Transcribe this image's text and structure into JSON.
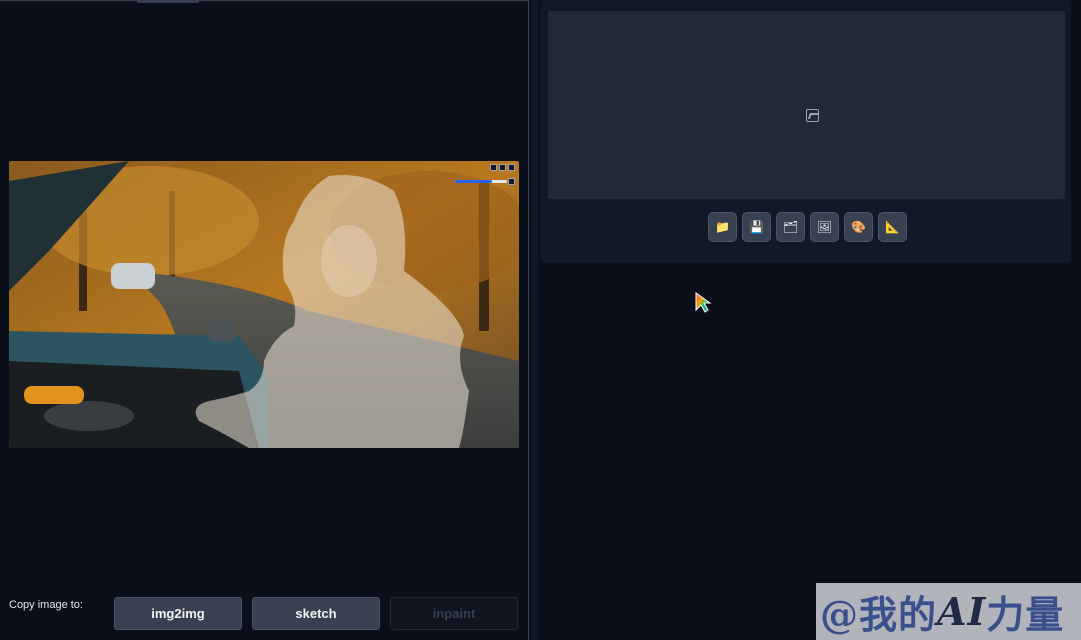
{
  "canvas": {
    "tools": [
      "expand-icon",
      "undo-icon",
      "close-icon"
    ],
    "brush_size_fraction": 0.72,
    "brush_color": "#111827"
  },
  "copy_row": {
    "label": "Copy image to:",
    "buttons": [
      {
        "label": "img2img",
        "enabled": true
      },
      {
        "label": "sketch",
        "enabled": true
      },
      {
        "label": "inpaint",
        "enabled": false
      }
    ]
  },
  "output": {
    "placeholder_icon": "image-icon",
    "toolbar": [
      {
        "icon": "folder-icon",
        "glyph": "📁"
      },
      {
        "icon": "save-icon",
        "glyph": "💾"
      },
      {
        "icon": "zip-icon",
        "glyph": "🗂"
      },
      {
        "icon": "send-image-icon",
        "glyph": "🖼"
      },
      {
        "icon": "palette-icon",
        "glyph": "🎨"
      },
      {
        "icon": "triangle-ruler-icon",
        "glyph": "📐"
      }
    ]
  },
  "watermark": {
    "text_prefix": "@我的",
    "text_ai": "AI",
    "text_suffix": "力量"
  },
  "colors": {
    "background": "#0b0f19",
    "panel": "#111827",
    "button": "#374151",
    "accent": "#2563eb"
  }
}
